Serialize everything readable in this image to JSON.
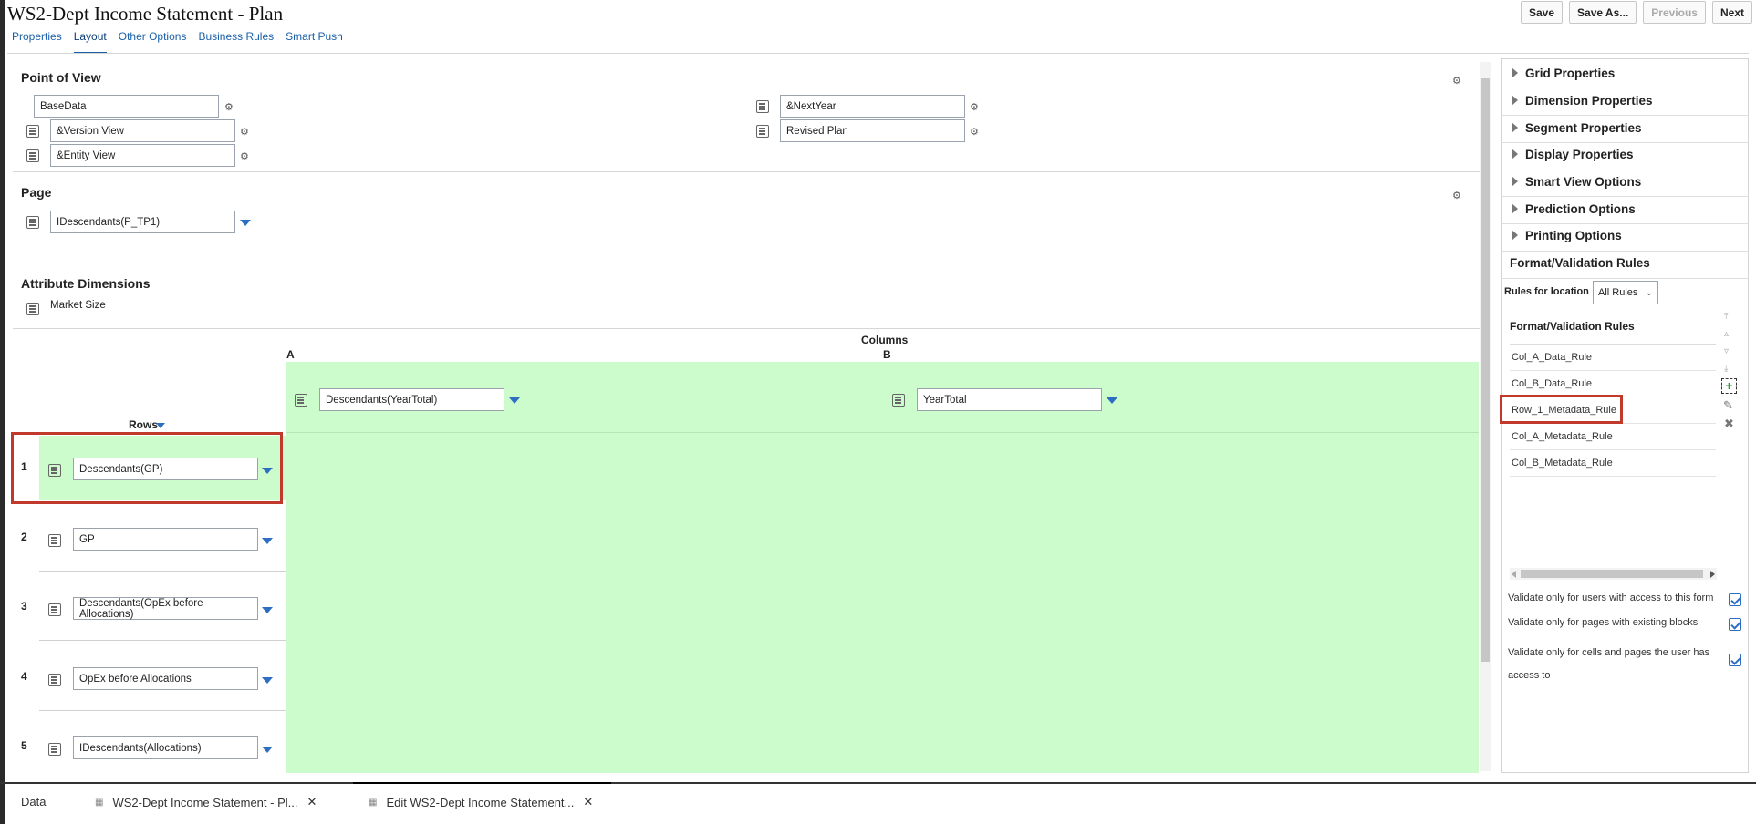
{
  "header": {
    "title": "WS2-Dept Income Statement - Plan",
    "buttons": {
      "save": "Save",
      "save_as": "Save As...",
      "previous": "Previous",
      "next": "Next"
    }
  },
  "tabs": [
    "Properties",
    "Layout",
    "Other Options",
    "Business Rules",
    "Smart Push"
  ],
  "pov": {
    "title": "Point of View",
    "fields": [
      "BaseData",
      "&Version View",
      "&Entity View",
      "&NextYear",
      "Revised Plan"
    ]
  },
  "page": {
    "title": "Page",
    "field": "IDescendants(P_TP1)"
  },
  "attribute": {
    "title": "Attribute Dimensions",
    "item": "Market Size"
  },
  "grid": {
    "columns_label": "Columns",
    "col_a": "A",
    "col_b": "B",
    "col_a_value": "Descendants(YearTotal)",
    "col_b_value": "YearTotal",
    "rows_label": "Rows",
    "rows": [
      {
        "num": "1",
        "value": "Descendants(GP)"
      },
      {
        "num": "2",
        "value": "GP"
      },
      {
        "num": "3",
        "value": "Descendants(OpEx before Allocations)"
      },
      {
        "num": "4",
        "value": "OpEx before Allocations"
      },
      {
        "num": "5",
        "value": "IDescendants(Allocations)"
      }
    ]
  },
  "right_panel": {
    "sections": [
      "Grid Properties",
      "Dimension Properties",
      "Segment Properties",
      "Display Properties",
      "Smart View Options",
      "Prediction Options",
      "Printing Options"
    ],
    "fv_title": "Format/Validation Rules",
    "rules_for_location_label": "Rules for location",
    "rules_for_location_value": "All Rules",
    "list_header": "Format/Validation Rules",
    "rules": [
      "Col_A_Data_Rule",
      "Col_B_Data_Rule",
      "Row_1_Metadata_Rule",
      "Col_A_Metadata_Rule",
      "Col_B_Metadata_Rule"
    ],
    "options": [
      "Validate only for users with access to this form",
      "Validate only for pages with existing blocks",
      "Validate only for cells and pages the user has access to"
    ]
  },
  "bottom_tabs": [
    "Data",
    "WS2-Dept Income Statement - Pl...",
    "Edit WS2-Dept Income Statement..."
  ]
}
